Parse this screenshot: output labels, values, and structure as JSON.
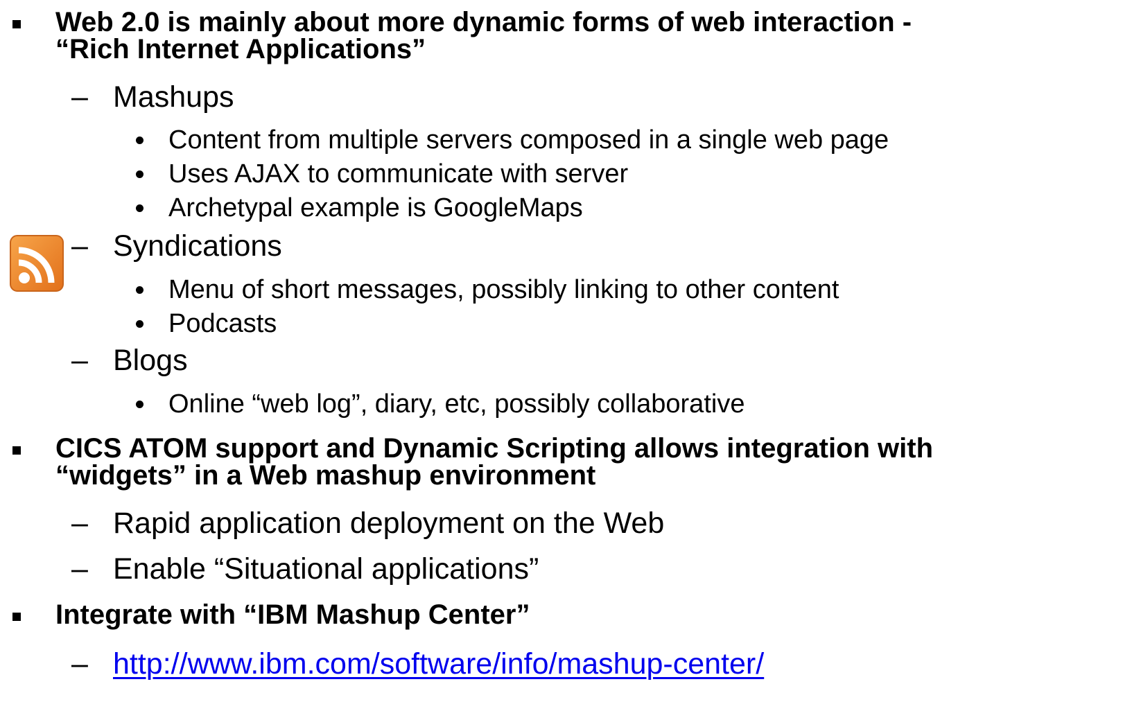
{
  "slide": {
    "bullets": [
      {
        "lines": [
          "Web 2.0 is mainly about more dynamic forms of web interaction -",
          "“Rich Internet Applications”"
        ],
        "subs": [
          {
            "text": "Mashups",
            "items": [
              "Content from multiple servers composed in a single web page",
              "Uses AJAX to communicate with server",
              "Archetypal example is GoogleMaps"
            ]
          },
          {
            "text": "Syndications",
            "items": [
              "Menu of short messages, possibly linking to other content",
              "Podcasts"
            ]
          },
          {
            "text": "Blogs",
            "items": [
              "Online “web log”, diary, etc, possibly collaborative"
            ]
          }
        ]
      },
      {
        "lines": [
          "CICS ATOM support and Dynamic Scripting allows integration with",
          "“widgets” in a Web mashup environment"
        ],
        "subs": [
          {
            "text": "Rapid application deployment on the Web"
          },
          {
            "text": "Enable “Situational applications”"
          }
        ]
      },
      {
        "lines": [
          "Integrate with “IBM Mashup Center”"
        ],
        "subs": [
          {
            "text": "http://www.ibm.com/software/info/mashup-center/"
          }
        ]
      }
    ],
    "icons": {
      "rss": "rss-feed-icon"
    },
    "colors": {
      "link": "#0000ee",
      "rss_orange": "#f08a24"
    }
  }
}
